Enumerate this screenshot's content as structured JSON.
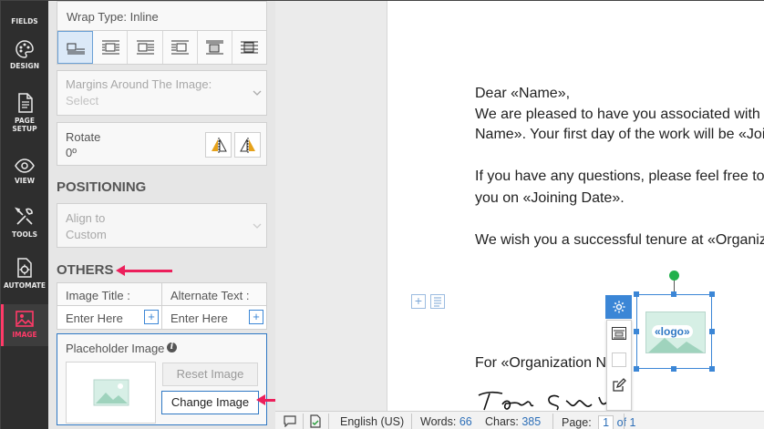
{
  "rail": {
    "items": [
      {
        "label": "FIELDS",
        "icon": "fields-icon"
      },
      {
        "label": "DESIGN",
        "icon": "palette-icon"
      },
      {
        "label": "PAGE SETUP",
        "icon": "page-setup-icon"
      },
      {
        "label": "VIEW",
        "icon": "eye-icon"
      },
      {
        "label": "TOOLS",
        "icon": "tools-icon"
      },
      {
        "label": "AUTOMATE",
        "icon": "automate-icon"
      },
      {
        "label": "IMAGE",
        "icon": "image-icon",
        "active": true
      }
    ],
    "active_color": "#ff3a68"
  },
  "panel": {
    "wrap_type": "Wrap Type: Inline",
    "margins_label": "Margins Around The Image:",
    "margins_value": "Select",
    "rotate_label": "Rotate",
    "rotate_value": "0º",
    "positioning_title": "POSITIONING",
    "align_label": "Align to",
    "align_value": "Custom",
    "others_title": "OTHERS",
    "image_title_label": "Image Title :",
    "alt_text_label": "Alternate Text :",
    "image_title_placeholder": "Enter Here",
    "alt_text_placeholder": "Enter Here",
    "placeholder_image_label": "Placeholder Image",
    "reset_image_label": "Reset Image",
    "change_image_label": "Change Image"
  },
  "document": {
    "lines": [
      "Dear  «Name»,",
      "We are pleased to have you associated with",
      "Name». Your first day of the work will be «Joi",
      "If you have any questions, please feel free to",
      "you on «Joining Date».",
      "We wish you a successful tenure at «Organiz",
      "For «Organization Na"
    ],
    "logo_placeholder": "«logo»"
  },
  "statusbar": {
    "language": "English (US)",
    "words_label": "Words:",
    "words_value": "66",
    "chars_label": "Chars:",
    "chars_value": "385",
    "page_label": "Page:",
    "page_value": "1",
    "page_total": "of 1"
  },
  "colors": {
    "accent": "#3b86d6",
    "annotation_arrow": "#ec1f5b",
    "handle_green": "#22b14c"
  }
}
